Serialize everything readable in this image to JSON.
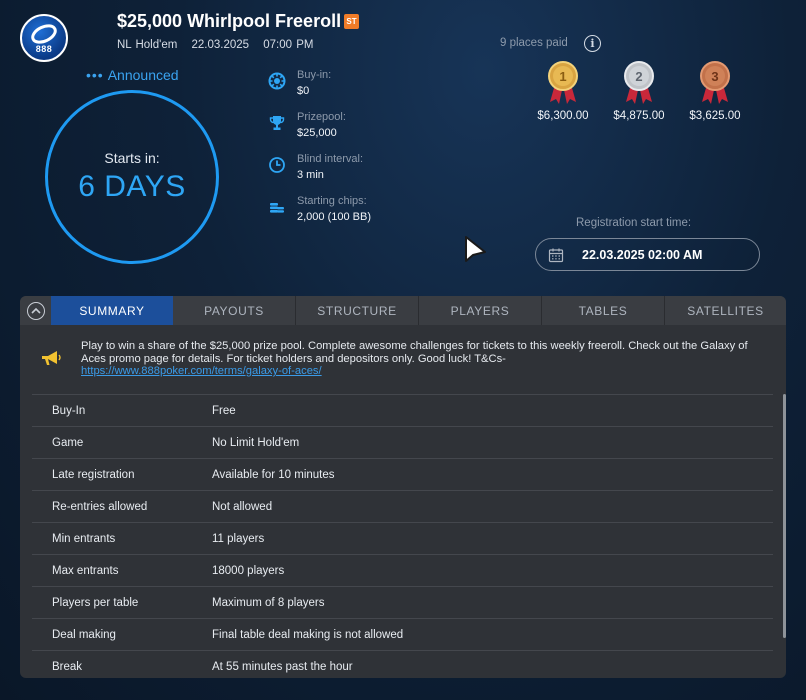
{
  "header": {
    "title": "$25,000 Whirlpool Freeroll",
    "badge": "ST",
    "logo_text": "888",
    "game": "NL Hold'em",
    "date": "22.03.2025",
    "time": "07:00 PM"
  },
  "status": {
    "dots": "•••",
    "label": "Announced"
  },
  "countdown": {
    "label": "Starts in:",
    "value": "6 DAYS"
  },
  "info": {
    "buyin": {
      "label": "Buy-in:",
      "value": "$0",
      "icon": "poker-chip-icon"
    },
    "prizepool": {
      "label": "Prizepool:",
      "value": "$25,000",
      "icon": "trophy-icon"
    },
    "blind": {
      "label": "Blind interval:",
      "value": "3 min",
      "icon": "clock-icon"
    },
    "chips": {
      "label": "Starting chips:",
      "value": "2,000 (100 BB)",
      "icon": "chip-stack-icon"
    }
  },
  "prizes": {
    "places_paid": "9 places paid",
    "info_glyph": "i",
    "medals": [
      {
        "rank": "1",
        "amount": "$6,300.00",
        "color": "#d9a441"
      },
      {
        "rank": "2",
        "amount": "$4,875.00",
        "color": "#bfc3c8"
      },
      {
        "rank": "3",
        "amount": "$3,625.00",
        "color": "#c2714a"
      }
    ]
  },
  "registration": {
    "label": "Registration start time:",
    "value": "22.03.2025 02:00 AM"
  },
  "tabs": [
    "SUMMARY",
    "PAYOUTS",
    "STRUCTURE",
    "PLAYERS",
    "TABLES",
    "SATELLITES"
  ],
  "notice": {
    "text": "Play to win a share of the $25,000 prize pool. Complete awesome challenges for tickets to this weekly freeroll. Check out the Galaxy of Aces promo page for details. For ticket holders and depositors only. Good luck! T&Cs-",
    "link": "https://www.888poker.com/terms/galaxy-of-aces/"
  },
  "summary": [
    {
      "key": "Buy-In",
      "value": "Free"
    },
    {
      "key": "Game",
      "value": "No Limit Hold'em"
    },
    {
      "key": "Late registration",
      "value": "Available for 10 minutes"
    },
    {
      "key": "Re-entries allowed",
      "value": "Not allowed"
    },
    {
      "key": "Min entrants",
      "value": "11 players"
    },
    {
      "key": "Max entrants",
      "value": "18000 players"
    },
    {
      "key": "Players per table",
      "value": "Maximum of 8 players"
    },
    {
      "key": "Deal making",
      "value": "Final table deal making is not allowed"
    },
    {
      "key": "Break",
      "value": "At 55 minutes past the hour"
    }
  ],
  "colors": {
    "accent": "#1e9af2",
    "tab_active": "#1c4f9b",
    "badge": "#f07c28"
  }
}
